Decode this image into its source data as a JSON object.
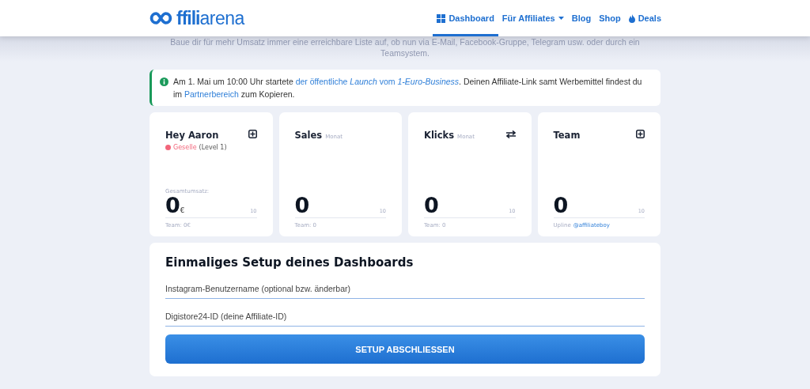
{
  "logo": {
    "bold": "ffili",
    "light": "arena"
  },
  "nav": [
    {
      "label": "Dashboard",
      "dropdown": false,
      "selected": true
    },
    {
      "label": "Für Affiliates",
      "dropdown": true,
      "selected": false
    },
    {
      "label": "Blog",
      "dropdown": false,
      "selected": false
    },
    {
      "label": "Shop",
      "dropdown": false,
      "selected": false
    },
    {
      "label": "Deals",
      "dropdown": false,
      "selected": false
    }
  ],
  "quote": [
    "Baue dir für mehr Umsatz immer eine erreichbare Liste auf, ob nun via E-Mail, Facebook-Gruppe, Telegram usw. oder durch ein",
    "Teamsystem."
  ],
  "notice": [
    {
      "text": "Am 1. Mai um 10:00 Uhr startete ",
      "link": false
    },
    {
      "text": "der öffentliche *Launch* vom *1-Euro-Business*",
      "link": true
    },
    {
      "text": ". Deinen Affiliate-Link samt Werbemittel findest du im ",
      "link": false
    },
    {
      "text": "Partnerbereich",
      "link": true
    },
    {
      "text": " zum Kopieren.",
      "link": false
    }
  ],
  "cards": [
    {
      "title": "Hey Aaron",
      "rank": {
        "name": "Geselle",
        "level": "(Level 1)",
        "color": "#f2657a"
      },
      "caption": "Gesamtumsatz:",
      "value": "0",
      "unit": "€",
      "max": "10",
      "footer": "Team: 0€"
    },
    {
      "title": "Sales",
      "subtitle": "Monat",
      "value": "0",
      "max": "10",
      "footer": "Team: 0"
    },
    {
      "title": "Klicks",
      "subtitle": "Monat",
      "value": "0",
      "max": "10",
      "footer": "Team: 0"
    },
    {
      "title": "Team",
      "value": "0",
      "max": "10",
      "footer": "Upline",
      "footer_link": "@affiliateboy"
    }
  ],
  "setup": {
    "title": "Einmaliges Setup deines Dashboards",
    "fields": [
      {
        "placeholder": "Instagram-Benutzername (optional bzw. änderbar)"
      },
      {
        "placeholder": "Digistore24-ID (deine Affiliate-ID)"
      }
    ],
    "button": "SETUP ABSCHLIESSEN"
  }
}
